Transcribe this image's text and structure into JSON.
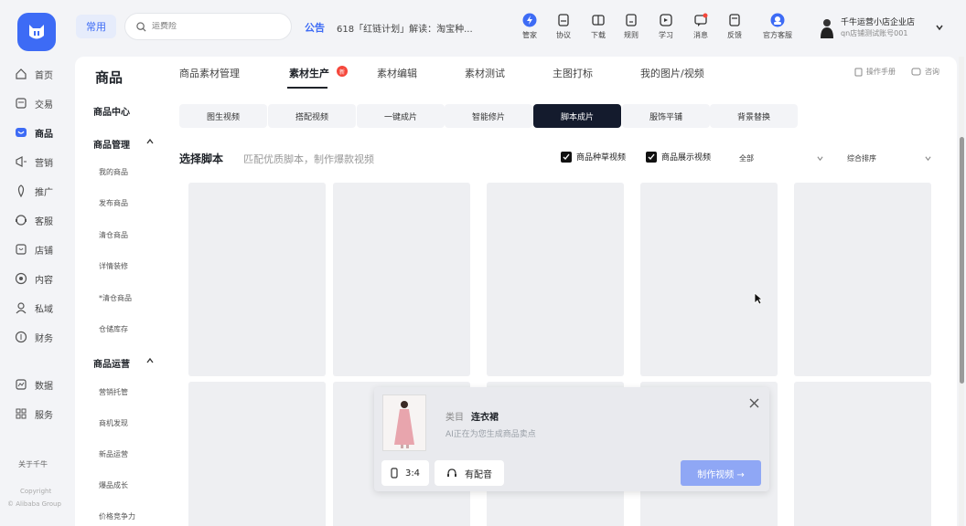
{
  "topbar": {
    "frequent": "常用",
    "search_placeholder": "运费险",
    "notice_tag": "公告",
    "notice_text": "618「红链计划」解读：淘宝种...",
    "tools": [
      {
        "label": "管家",
        "icon": "butler-icon"
      },
      {
        "label": "协议",
        "icon": "agreement-icon"
      },
      {
        "label": "下载",
        "icon": "download-icon"
      },
      {
        "label": "规则",
        "icon": "rules-icon"
      },
      {
        "label": "学习",
        "icon": "study-icon"
      },
      {
        "label": "消息",
        "icon": "message-icon"
      },
      {
        "label": "反馈",
        "icon": "feedback-icon"
      },
      {
        "label": "官方客服",
        "icon": "customer-service-icon"
      }
    ],
    "user_name": "千牛运营小店企业店",
    "user_sub": "qn店铺测试账号001"
  },
  "leftnav": {
    "items": [
      {
        "label": "首页",
        "icon": "home-icon"
      },
      {
        "label": "交易",
        "icon": "trade-icon"
      },
      {
        "label": "商品",
        "icon": "goods-icon"
      },
      {
        "label": "营销",
        "icon": "marketing-icon"
      },
      {
        "label": "推广",
        "icon": "promotion-icon"
      },
      {
        "label": "客服",
        "icon": "service-icon"
      },
      {
        "label": "店铺",
        "icon": "shop-icon"
      },
      {
        "label": "内容",
        "icon": "content-icon"
      },
      {
        "label": "私域",
        "icon": "private-domain-icon"
      },
      {
        "label": "财务",
        "icon": "finance-icon"
      },
      {
        "label": "数据",
        "icon": "data-icon"
      },
      {
        "label": "服务",
        "icon": "services-icon"
      }
    ],
    "about": "关于千牛",
    "copyright1": "Copyright",
    "copyright2": "© Alibaba Group"
  },
  "subnav": {
    "title": "商品",
    "center": "商品中心",
    "manage_head": "商品管理",
    "manage_items": [
      "我的商品",
      "发布商品",
      "清仓商品",
      "详情装修",
      "*清仓商品",
      "仓储库存"
    ],
    "ops_head": "商品运营",
    "ops_items": [
      "营销托管",
      "商机发现",
      "新品运营",
      "爆品成长",
      "价格竞争力"
    ]
  },
  "tabs": {
    "items": [
      "商品素材管理",
      "素材生产",
      "素材编辑",
      "素材测试",
      "主图打标",
      "我的图片/视频"
    ],
    "new_badge": "新",
    "manual": "操作手册",
    "consult": "咨询"
  },
  "chips": [
    "图生视频",
    "搭配视频",
    "一键成片",
    "智能修片",
    "脚本成片",
    "服饰平铺",
    "背景替换"
  ],
  "filters": {
    "title": "选择脚本",
    "desc": "匹配优质脚本，制作爆款视频",
    "checkbox1": "商品种草视频",
    "checkbox2": "商品展示视频",
    "dropdown1": "全部",
    "dropdown2": "综合排序"
  },
  "popup": {
    "category_label": "类目",
    "category_value": "连衣裙",
    "generating": "AI正在为您生成商品卖点",
    "ratio": "3:4",
    "voice": "有配音",
    "make_button": "制作视频 →"
  }
}
